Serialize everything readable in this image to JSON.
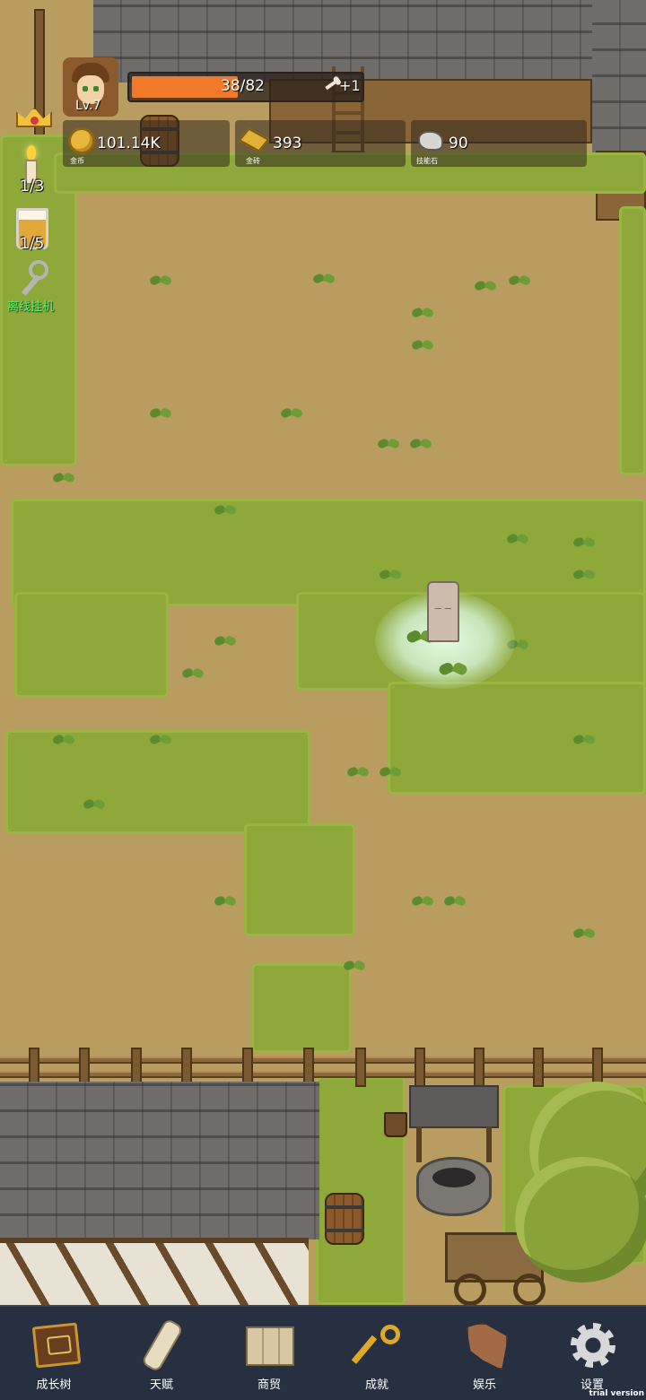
{
  "hud": {
    "level": "Lv.7",
    "xp_text": "38/82",
    "xp_progress": 0.4634,
    "bone_bonus": "+1",
    "resources": [
      {
        "name": "金币",
        "value": "101.14K",
        "icon": "gold-coin-icon"
      },
      {
        "name": "金砖",
        "value": "393",
        "icon": "gold-bar-icon"
      },
      {
        "name": "技能石",
        "value": "90",
        "icon": "skill-stone-icon"
      }
    ]
  },
  "side": {
    "candle_count": "1/3",
    "cup_count": "1/5",
    "auto_label": "离线挂机"
  },
  "nav": [
    {
      "label": "成长树",
      "icon": "growth-tree-book-icon"
    },
    {
      "label": "天赋",
      "icon": "talent-scroll-icon"
    },
    {
      "label": "商贸",
      "icon": "trade-map-icon"
    },
    {
      "label": "成就",
      "icon": "achievement-key-icon"
    },
    {
      "label": "娱乐",
      "icon": "entertainment-leaf-icon"
    },
    {
      "label": "设置",
      "icon": "settings-gear-icon"
    }
  ],
  "watermark": "trial version",
  "colors": {
    "xp_bar": "#f07a2a",
    "nav_bg": "#273040",
    "auto_label": "#5ef05e"
  }
}
